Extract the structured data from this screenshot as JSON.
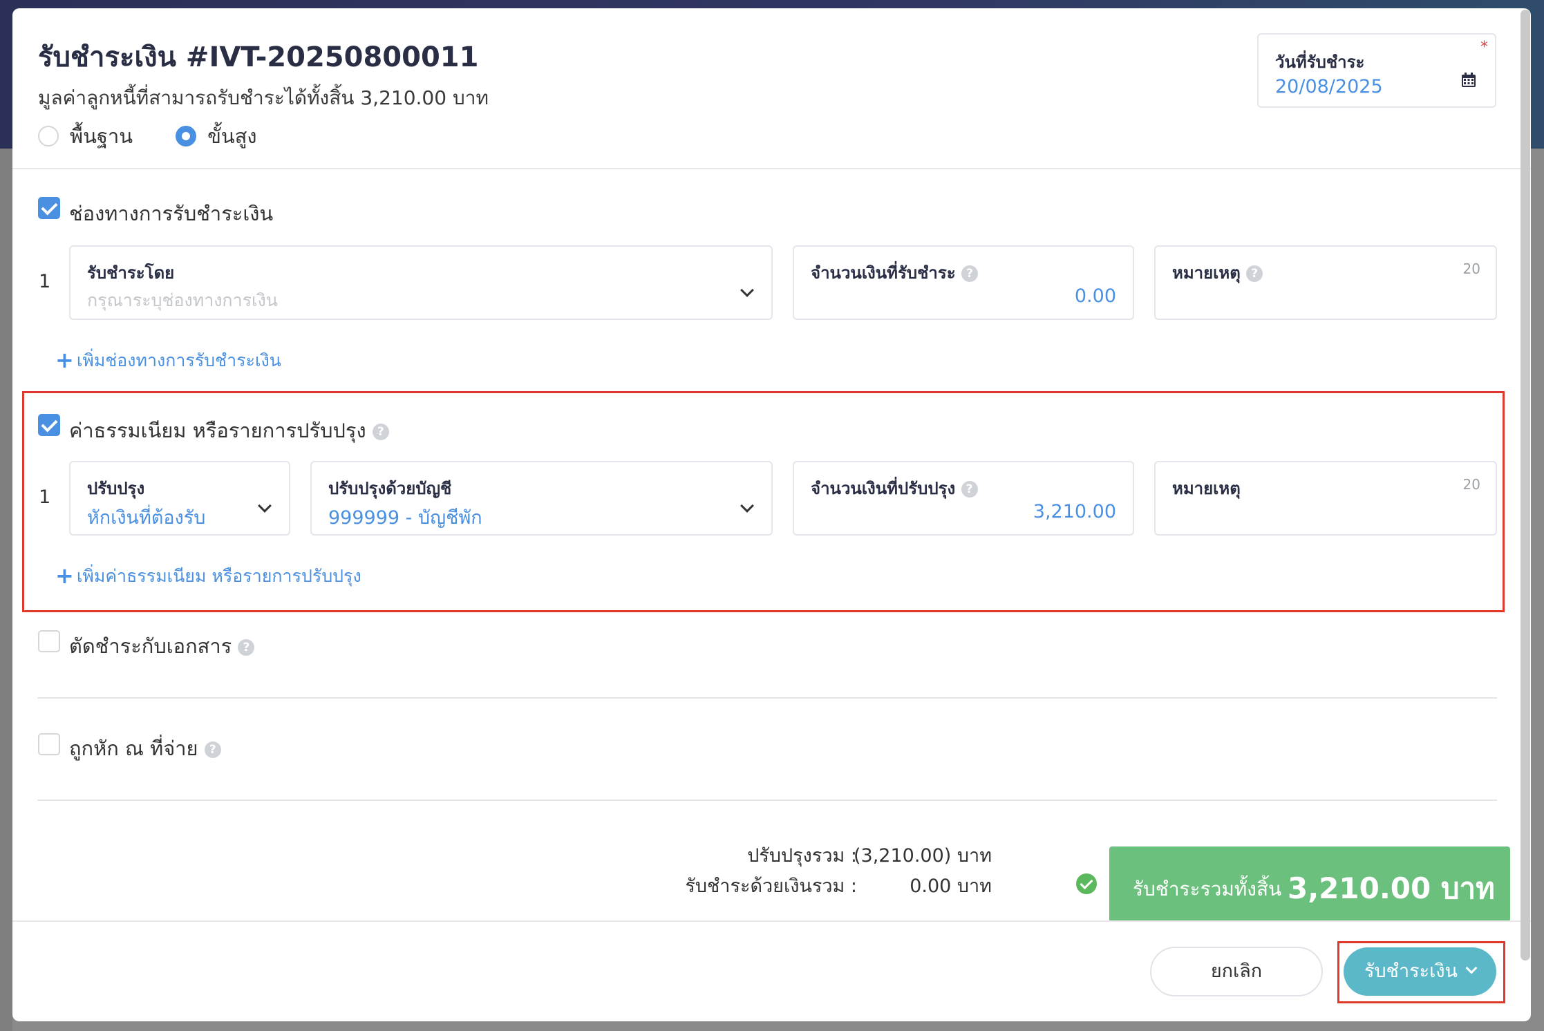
{
  "header": {
    "title": "รับชำระเงิน #IVT-20250800011",
    "subtitle": "มูลค่าลูกหนี้ที่สามารถรับชำระได้ทั้งสิ้น 3,210.00 บาท",
    "mode_options": [
      {
        "label": "พื้นฐาน",
        "selected": false
      },
      {
        "label": "ขั้นสูง",
        "selected": true
      }
    ],
    "date": {
      "label": "วันที่รับชำระ",
      "required_mark": "*",
      "value": "20/08/2025",
      "icon": "calendar-icon"
    }
  },
  "payment_channels": {
    "checked": true,
    "title": "ช่องทางการรับชำระเงิน",
    "rows": [
      {
        "index": "1",
        "method": {
          "label": "รับชำระโดย",
          "placeholder": "กรุณาระบุช่องทางการเงิน",
          "value": ""
        },
        "amount": {
          "label": "จำนวนเงินที่รับชำระ",
          "value": "0.00"
        },
        "note": {
          "label": "หมายเหตุ",
          "counter": "20",
          "value": ""
        }
      }
    ],
    "add_label": "เพิ่มช่องทางการรับชำระเงิน"
  },
  "fees_adjustments": {
    "checked": true,
    "title": "ค่าธรรมเนียม หรือรายการปรับปรุง",
    "rows": [
      {
        "index": "1",
        "type": {
          "label": "ปรับปรุง",
          "value": "หักเงินที่ต้องรับ"
        },
        "account": {
          "label": "ปรับปรุงด้วยบัญชี",
          "value": "999999 - บัญชีพัก"
        },
        "amount": {
          "label": "จำนวนเงินที่ปรับปรุง",
          "value": "3,210.00"
        },
        "note": {
          "label": "หมายเหตุ",
          "counter": "20",
          "value": ""
        }
      }
    ],
    "add_label": "เพิ่มค่าธรรมเนียม หรือรายการปรับปรุง"
  },
  "offset_documents": {
    "checked": false,
    "title": "ตัดชำระกับเอกสาร"
  },
  "withholding": {
    "checked": false,
    "title": "ถูกหัก ณ ที่จ่าย"
  },
  "summary": {
    "adjust_label": "ปรับปรุงรวม :",
    "adjust_value": "(3,210.00) บาท",
    "cash_label": "รับชำระด้วยเงินรวม :",
    "cash_value": "0.00 บาท",
    "total_label": "รับชำระรวมทั้งสิ้น",
    "total_value": "3,210.00 บาท"
  },
  "footer": {
    "cancel_label": "ยกเลิก",
    "submit_label": "รับชำระเงิน"
  },
  "colors": {
    "accent": "#4a90e2",
    "success": "#6cc07e",
    "submit": "#5bb8c8",
    "highlight": "#e0392b"
  }
}
